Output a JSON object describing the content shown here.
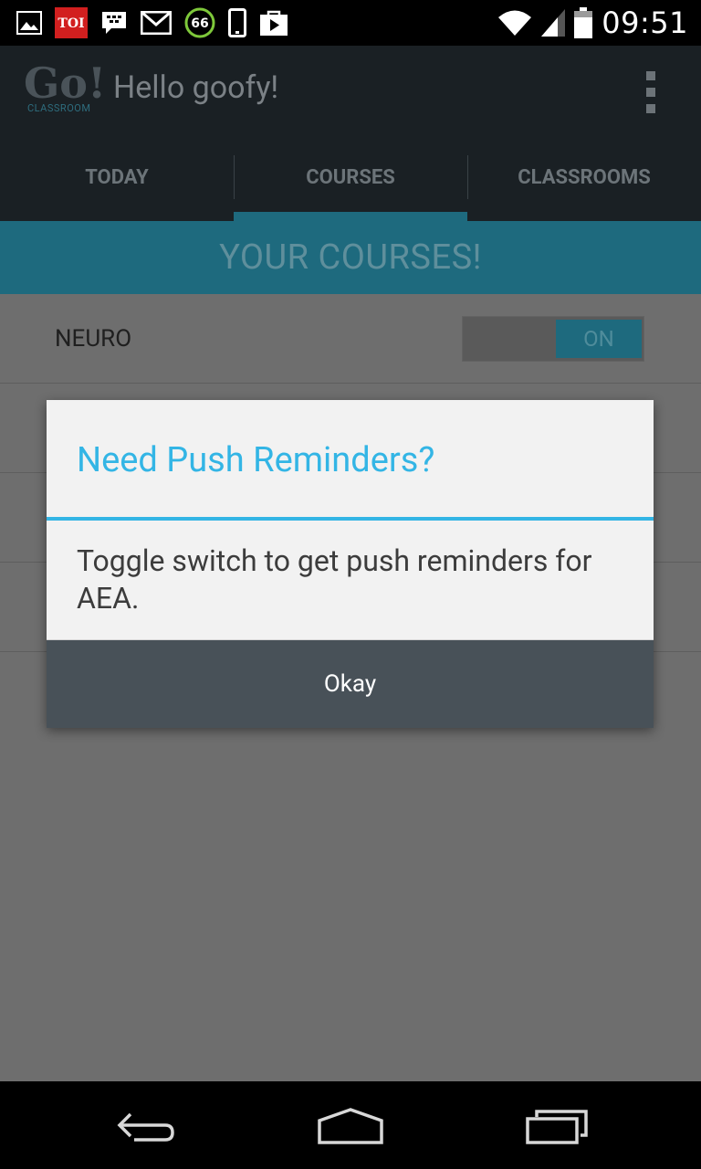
{
  "status_bar": {
    "time": "09:51",
    "left_icons": [
      "gallery-icon",
      "toi-icon",
      "bbm-icon",
      "gmail-icon",
      "sixty-six-icon",
      "phone-icon",
      "play-store-icon"
    ],
    "toi_label": "TOI",
    "badge_number": "66",
    "right_icons": [
      "wifi-icon",
      "signal-icon",
      "battery-icon"
    ]
  },
  "app_bar": {
    "logo_text": "Go!",
    "logo_subtext": "CLASSROOM",
    "title": "Hello goofy!",
    "overflow_icon": "overflow-menu-icon"
  },
  "tabs": [
    {
      "label": "TODAY",
      "active": false
    },
    {
      "label": "COURSES",
      "active": true
    },
    {
      "label": "CLASSROOMS",
      "active": false
    }
  ],
  "banner": {
    "text": "YOUR COURSES!"
  },
  "courses": [
    {
      "name": "NEURO",
      "switch_label": "ON"
    }
  ],
  "dialog": {
    "title": "Need Push Reminders?",
    "message": "Toggle switch to get push reminders for AEA.",
    "button": "Okay"
  },
  "nav_bar": {
    "icons": [
      "back-icon",
      "home-icon",
      "recent-apps-icon"
    ]
  },
  "colors": {
    "accent": "#33b5e5",
    "dim_overlay": "#6e6e6e",
    "dialog_button": "#485158"
  }
}
